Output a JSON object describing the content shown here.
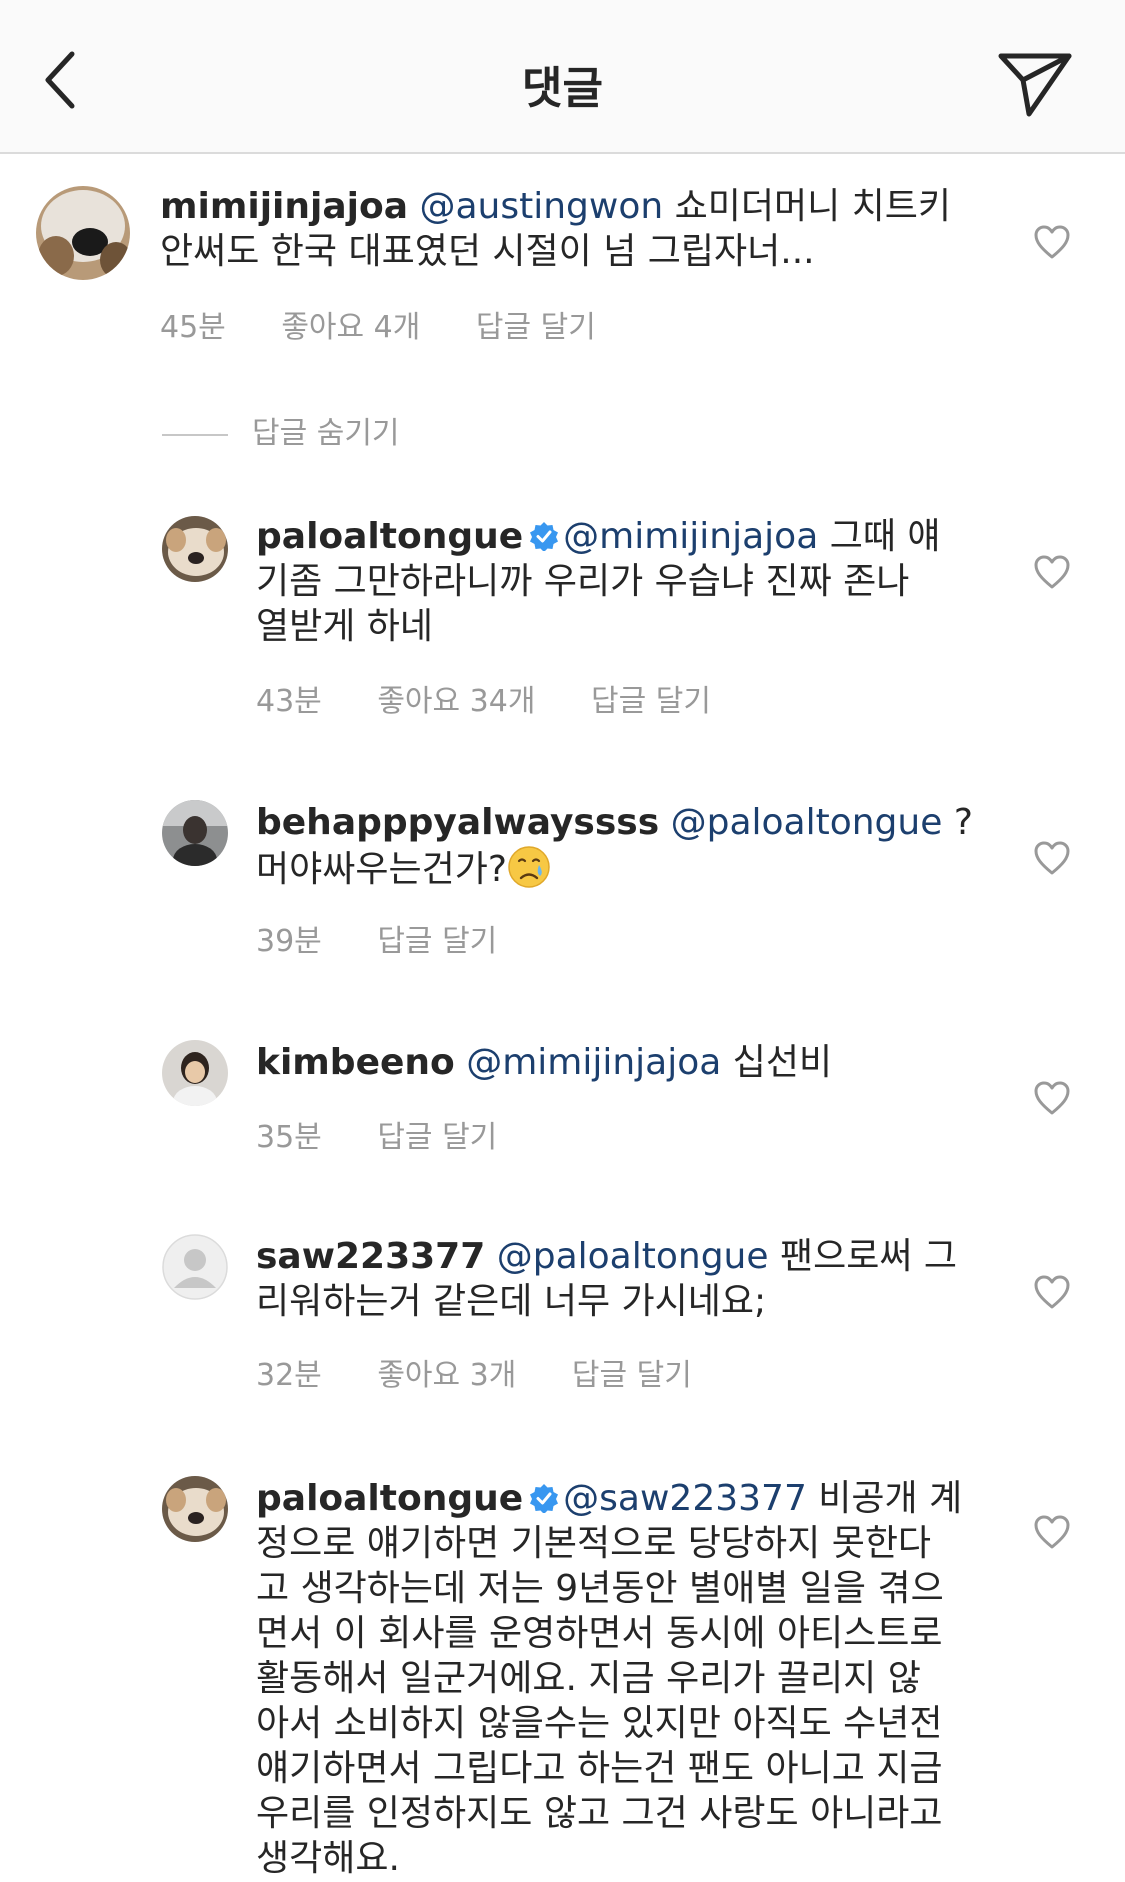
{
  "header": {
    "title": "댓글",
    "back_icon": "chevron-left-icon",
    "send_icon": "paper-plane-icon"
  },
  "comments": [
    {
      "username": "mimijinjajoa",
      "verified": false,
      "mention": "@austingwon",
      "lines": [
        " 쇼미더머니 치트키",
        "안써도 한국 대표였던 시절이 넘 그립자너..."
      ],
      "time": "45분",
      "likes": "좋아요 4개",
      "reply": "답글 달기"
    },
    {
      "username": "paloaltongue",
      "verified": true,
      "mention": "@mimijinjajoa",
      "lines": [
        " 그때 얘",
        "기좀 그만하라니까 우리가 우습냐 진짜 존나",
        "열받게 하네"
      ],
      "time": "43분",
      "likes": "좋아요 34개",
      "reply": "답글 달기"
    },
    {
      "username": "behapppyalwayssss",
      "verified": false,
      "mention": "@paloaltongue",
      "lines": [
        " ?",
        "머야싸우는건가?"
      ],
      "emoji": "crying-face-icon",
      "time": "39분",
      "reply": "답글 달기"
    },
    {
      "username": "kimbeeno",
      "verified": false,
      "mention": "@mimijinjajoa",
      "lines": [
        " 십선비"
      ],
      "time": "35분",
      "reply": "답글 달기"
    },
    {
      "username": "saw223377",
      "verified": false,
      "mention": "@paloaltongue",
      "lines": [
        " 팬으로써 그",
        "리워하는거 같은데 너무 가시네요;"
      ],
      "time": "32분",
      "likes": "좋아요 3개",
      "reply": "답글 달기"
    },
    {
      "username": "paloaltongue",
      "verified": true,
      "mention": "@saw223377",
      "lines": [
        " 비공개 계",
        "정으로 얘기하면 기본적으로 당당하지 못한다",
        "고 생각하는데 저는 9년동안 별애별 일을 겪으",
        "면서 이 회사를 운영하면서 동시에 아티스트로",
        "활동해서 일군거에요. 지금 우리가 끌리지 않",
        "아서 소비하지 않을수는 있지만 아직도 수년전",
        "얘기하면서 그립다고 하는건 팬도 아니고 지금",
        "우리를 인정하지도 않고 그건 사랑도 아니라고",
        "생각해요."
      ]
    }
  ],
  "hide_replies": "답글 숨기기",
  "colors": {
    "text": "#262626",
    "mention": "#1c3f6e",
    "meta": "#999999",
    "verified": "#3897f0",
    "header_bg": "#fafafa"
  }
}
